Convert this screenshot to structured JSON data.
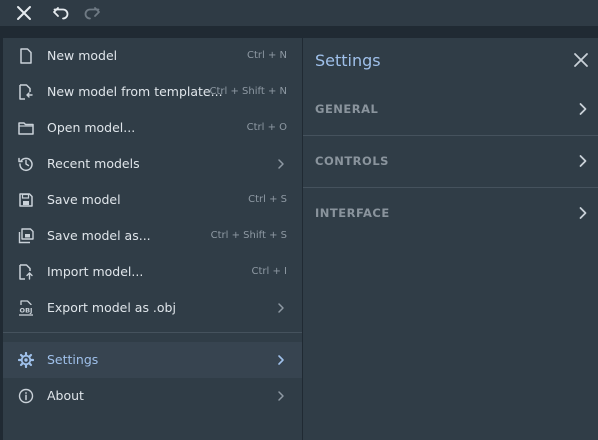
{
  "toolbar": {
    "close_icon": "close-icon",
    "undo_icon": "undo-icon",
    "redo_icon": "redo-icon"
  },
  "menu": {
    "items": [
      {
        "label": "New model",
        "shortcut": "Ctrl + N",
        "icon": "file-icon"
      },
      {
        "label": "New model from template...",
        "shortcut": "Ctrl + Shift + N",
        "icon": "file-template-icon"
      },
      {
        "label": "Open model...",
        "shortcut": "Ctrl + O",
        "icon": "folder-icon"
      },
      {
        "label": "Recent models",
        "shortcut": "",
        "icon": "history-icon",
        "submenu": true
      },
      {
        "label": "Save model",
        "shortcut": "Ctrl + S",
        "icon": "save-icon"
      },
      {
        "label": "Save model as...",
        "shortcut": "Ctrl + Shift + S",
        "icon": "save-as-icon"
      },
      {
        "label": "Import model...",
        "shortcut": "Ctrl + I",
        "icon": "import-icon"
      },
      {
        "label": "Export model as .obj",
        "shortcut": "",
        "icon": "export-obj-icon",
        "submenu": true
      },
      {
        "label": "Settings",
        "shortcut": "",
        "icon": "gear-icon",
        "submenu": true,
        "active": true
      },
      {
        "label": "About",
        "shortcut": "",
        "icon": "info-icon",
        "submenu": true
      }
    ]
  },
  "settings": {
    "title": "Settings",
    "sections": [
      {
        "label": "GENERAL"
      },
      {
        "label": "CONTROLS"
      },
      {
        "label": "INTERFACE"
      }
    ]
  },
  "colors": {
    "background": "#202a33",
    "panel": "#303d47",
    "active_row": "#374450",
    "accent": "#9fc0ea"
  }
}
